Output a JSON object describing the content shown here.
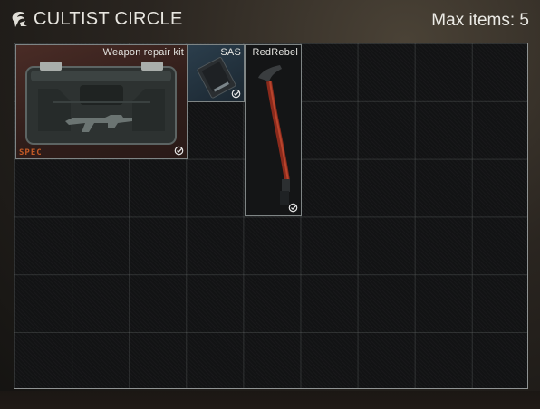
{
  "header": {
    "title": "CULTIST CIRCLE",
    "max_items": "Max items: 5",
    "logo_icon": "cultist-sigil-icon"
  },
  "items": [
    {
      "label": "Weapon repair kit",
      "badge": "SPEC",
      "icon": "weapon-repair-kit-icon",
      "status_icon": "check-circle-icon"
    },
    {
      "label": "SAS",
      "icon": "sas-drive-icon",
      "status_icon": "check-circle-icon"
    },
    {
      "label": "RedRebel",
      "icon": "red-rebel-icepick-icon",
      "status_icon": "check-circle-icon"
    }
  ],
  "colors": {
    "accent_spec": "#c25a26",
    "item_bg_repair": "#3a2420",
    "item_bg_sas": "#1f2e3a",
    "grid_bg": "#121314"
  }
}
